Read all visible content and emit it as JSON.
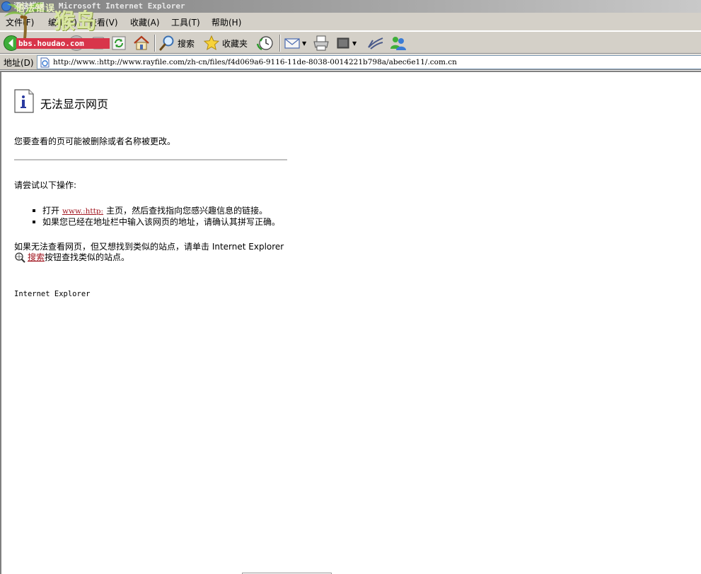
{
  "window": {
    "title": "语法错误 - Microsoft Internet Explorer"
  },
  "menu": {
    "items": [
      "文件(F)",
      "编辑(E)",
      "查看(V)",
      "收藏(A)",
      "工具(T)",
      "帮助(H)"
    ]
  },
  "toolbar": {
    "back_label": "后退",
    "search_label": "搜索",
    "favorites_label": "收藏夹"
  },
  "address": {
    "label": "地址(D)",
    "value": "http://www.:http://www.rayfile.com/zh-cn/files/f4d069a6-9116-11de-8038-0014221b798a/abec6e11/.com.cn"
  },
  "content": {
    "title": "无法显示网页",
    "description": "您要查看的页可能被删除或者名称被更改。",
    "try_heading": "请尝试以下操作:",
    "suggestion1_prefix": "打开",
    "suggestion1_link": "www.:http:",
    "suggestion1_suffix": "主页，然后查找指向您感兴趣信息的链接。",
    "suggestion2": "如果您已经在地址栏中输入该网页的地址，请确认其拼写正确。",
    "search_hint_line1": "如果无法查看网页，但又想找到类似的站点，请单击 Internet Explorer",
    "search_link": "搜索",
    "search_hint_line2_suffix": "按钮查找类似的站点。",
    "brand": "Internet Explorer"
  },
  "watermark": {
    "script_text": "语法错误",
    "big_text": "猴岛",
    "url_text": "bbs.houdao.com"
  }
}
